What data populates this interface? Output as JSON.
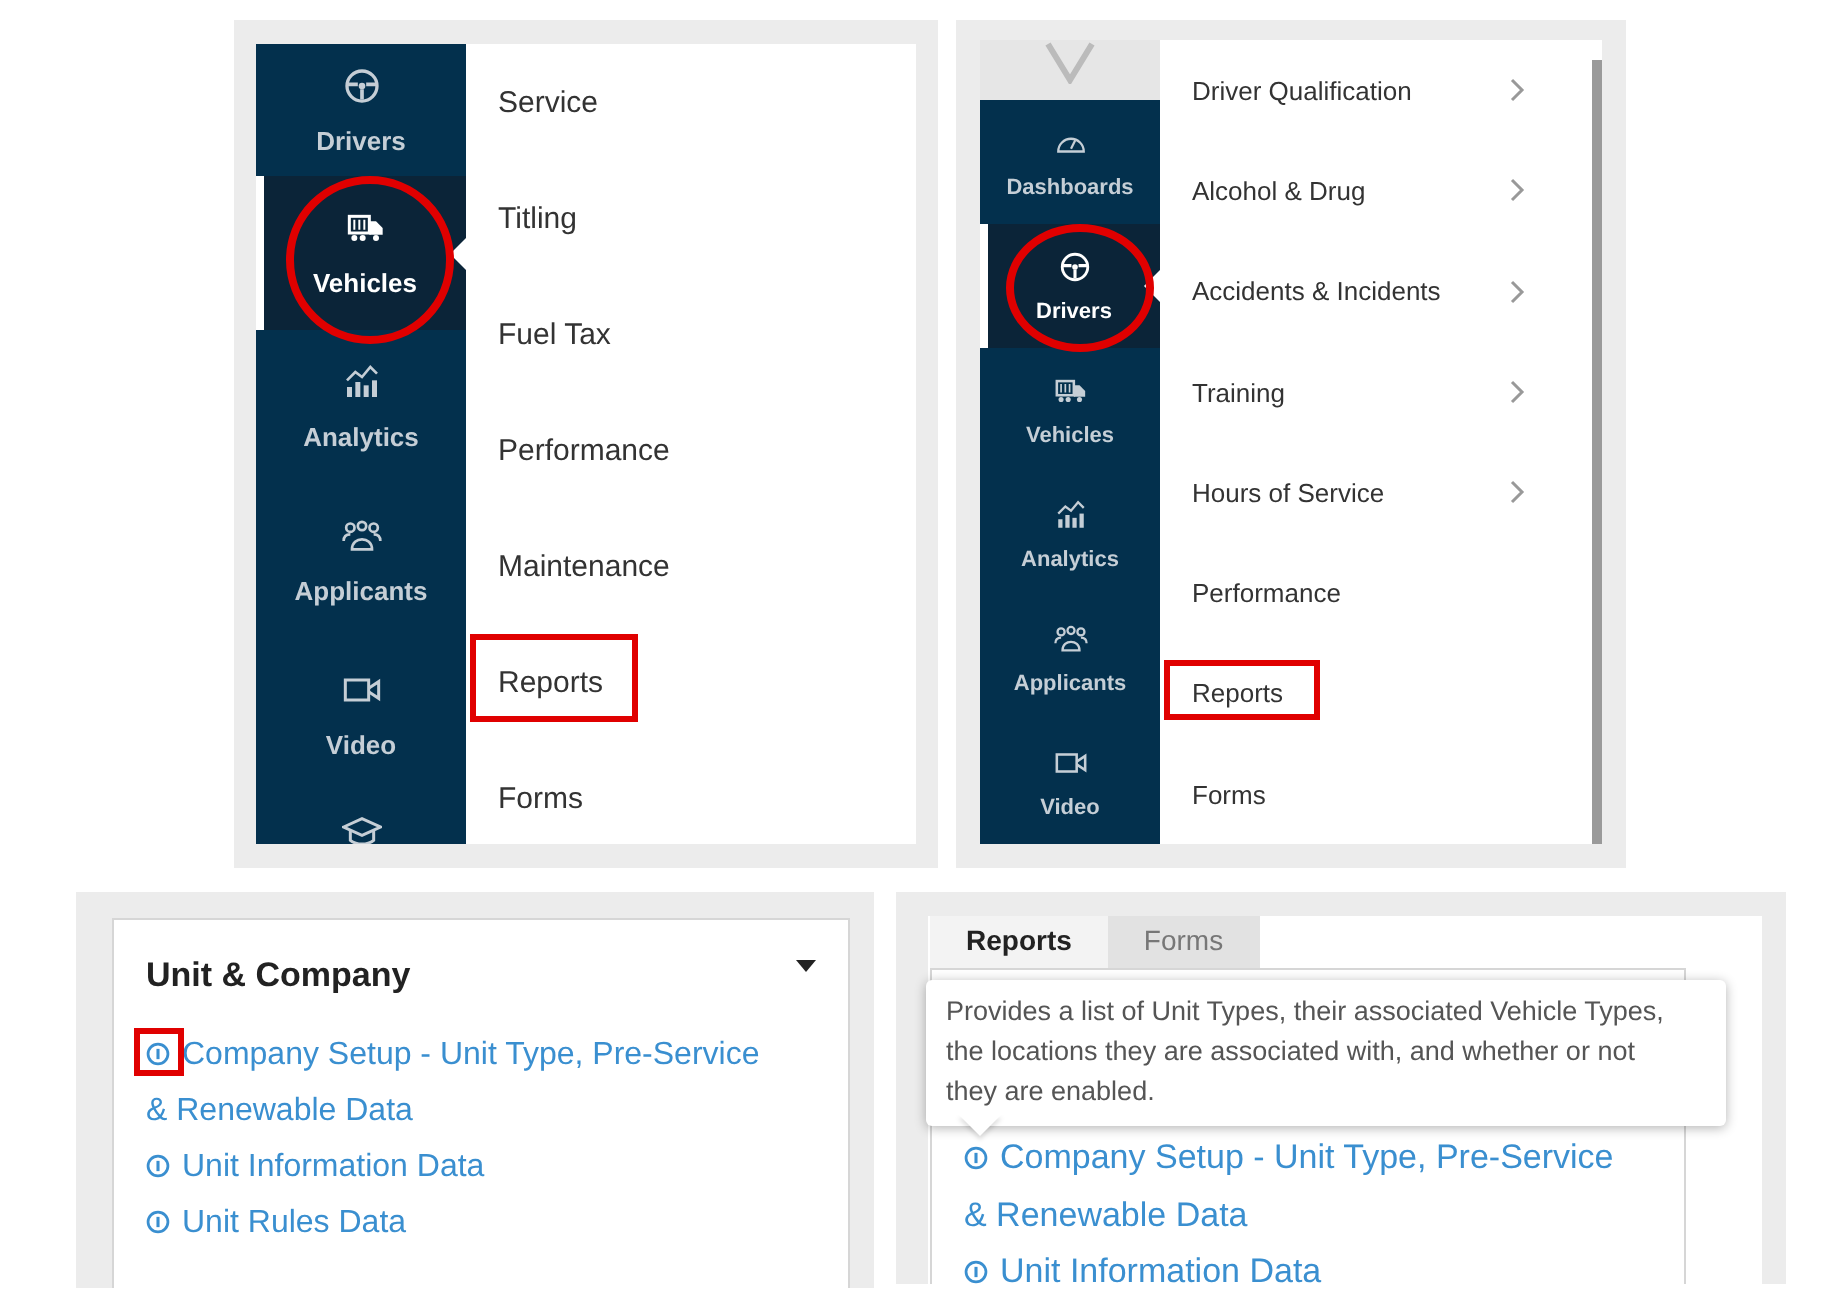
{
  "nav_panels": [
    {
      "sidebar": [
        {
          "label": "Drivers",
          "kind": "steering-wheel",
          "selected": false,
          "circled": false
        },
        {
          "label": "Vehicles",
          "kind": "truck",
          "selected": true,
          "circled": true
        },
        {
          "label": "Analytics",
          "kind": "chart",
          "selected": false,
          "circled": false
        },
        {
          "label": "Applicants",
          "kind": "people",
          "selected": false,
          "circled": false
        },
        {
          "label": "Video",
          "kind": "camera",
          "selected": false,
          "circled": false
        },
        {
          "kind": "cap",
          "selected": false,
          "circled": false
        }
      ],
      "menu": [
        {
          "label": "Service",
          "submenu": false,
          "boxed": false
        },
        {
          "label": "Titling",
          "submenu": false,
          "boxed": false
        },
        {
          "label": "Fuel Tax",
          "submenu": false,
          "boxed": false
        },
        {
          "label": "Performance",
          "submenu": false,
          "boxed": false
        },
        {
          "label": "Maintenance",
          "submenu": false,
          "boxed": false
        },
        {
          "label": "Reports",
          "submenu": false,
          "boxed": true
        },
        {
          "label": "Forms",
          "submenu": false,
          "boxed": false
        }
      ]
    },
    {
      "logo": true,
      "sidebar": [
        {
          "label": "Dashboards",
          "kind": "gauge",
          "selected": false,
          "circled": false
        },
        {
          "label": "Drivers",
          "kind": "steering-wheel",
          "selected": true,
          "circled": true
        },
        {
          "label": "Vehicles",
          "kind": "truck",
          "selected": false,
          "circled": false
        },
        {
          "label": "Analytics",
          "kind": "chart",
          "selected": false,
          "circled": false
        },
        {
          "label": "Applicants",
          "kind": "people",
          "selected": false,
          "circled": false
        },
        {
          "label": "Video",
          "kind": "camera",
          "selected": false,
          "circled": false
        }
      ],
      "menu": [
        {
          "label": "Driver Qualification",
          "submenu": true,
          "boxed": false
        },
        {
          "label": "Alcohol & Drug",
          "submenu": true,
          "boxed": false
        },
        {
          "label": "Accidents & Incidents",
          "submenu": true,
          "boxed": false
        },
        {
          "label": "Training",
          "submenu": true,
          "boxed": false
        },
        {
          "label": "Hours of Service",
          "submenu": true,
          "boxed": false
        },
        {
          "label": "Performance",
          "submenu": false,
          "boxed": false
        },
        {
          "label": "Reports",
          "submenu": false,
          "boxed": true
        },
        {
          "label": "Forms",
          "submenu": false,
          "boxed": false
        }
      ]
    }
  ],
  "report_card": {
    "title": "Unit & Company",
    "links": [
      {
        "label": "Company Setup - Unit Type, Pre-Service & Renewable Data",
        "icon_boxed": true
      },
      {
        "label": "Unit Information Data",
        "icon_boxed": false
      },
      {
        "label": "Unit Rules Data",
        "icon_boxed": false
      }
    ]
  },
  "tooltip_panel": {
    "tabs": [
      {
        "label": "Reports",
        "selected": true
      },
      {
        "label": "Forms",
        "selected": false
      }
    ],
    "tooltip": "Provides a list of Unit Types, their associated Vehicle Types, the locations they are associated with, and whether or not they are enabled.",
    "links": [
      {
        "label": "Company Setup - Unit Type, Pre-Service & Renewable Data"
      },
      {
        "label": "Unit Information Data"
      }
    ]
  }
}
